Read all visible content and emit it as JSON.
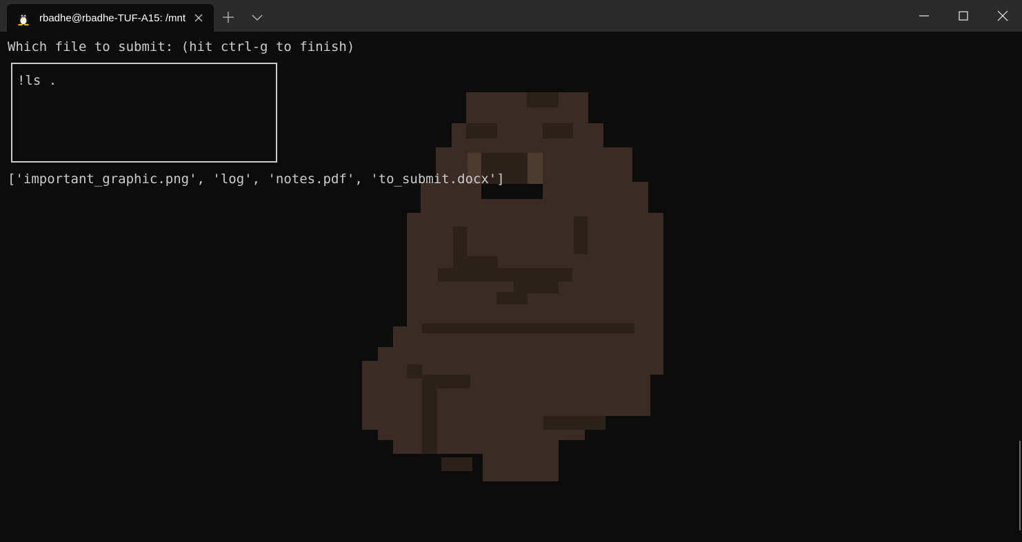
{
  "tab": {
    "title": "rbadhe@rbadhe-TUF-A15: /mnt",
    "icon": "linux-penguin-icon"
  },
  "titlebar_buttons": {
    "new_tab_icon": "plus-icon",
    "dropdown_icon": "chevron-down-icon",
    "minimize_icon": "minimize-icon",
    "maximize_icon": "maximize-icon",
    "close_icon": "close-icon"
  },
  "terminal": {
    "prompt": "Which file to submit: (hit ctrl-g to finish)",
    "input_value": "!ls .",
    "output": "['important_graphic.png', 'log', 'notes.pdf', 'to_submit.docx']",
    "background_image": "pixel-art-mascot"
  },
  "colors": {
    "terminal_bg": "#0c0c0c",
    "titlebar_bg": "#2b2b2b",
    "text": "#cccccc",
    "mascot": "#3a2b25"
  }
}
